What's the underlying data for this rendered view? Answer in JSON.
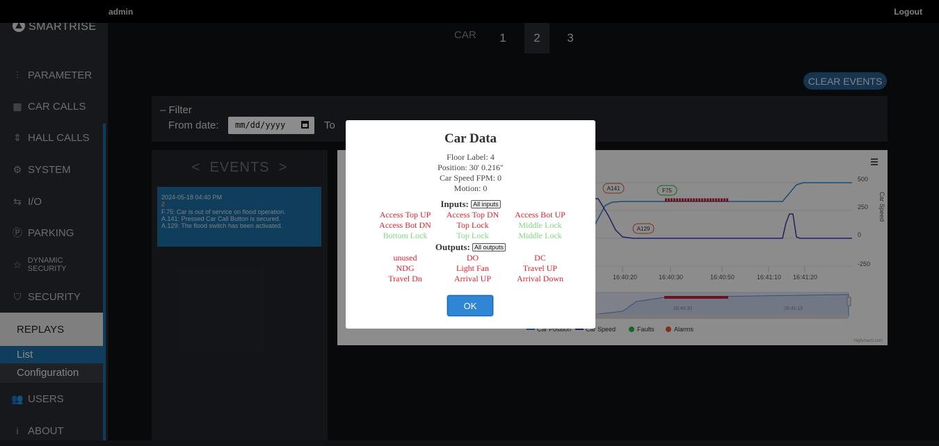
{
  "header": {
    "user": "admin",
    "logout": "Logout"
  },
  "brand": {
    "name": "SMARTRISE"
  },
  "sidebar": {
    "items": [
      {
        "label": "PARAMETER",
        "icon": "sliders-icon"
      },
      {
        "label": "CAR CALLS",
        "icon": "car-panel-icon"
      },
      {
        "label": "HALL CALLS",
        "icon": "up-down-icon"
      },
      {
        "label": "SYSTEM",
        "icon": "gear-icon"
      },
      {
        "label": "I/O",
        "icon": "io-arrows-icon"
      },
      {
        "label": "PARKING",
        "icon": "parking-icon"
      },
      {
        "label": "DYNAMIC SECURITY",
        "icon": "star-icon"
      },
      {
        "label": "SECURITY",
        "icon": "shield-icon"
      }
    ],
    "replays": {
      "label": "REPLAYS",
      "sub": [
        "List",
        "Configuration"
      ]
    },
    "bottom": [
      {
        "label": "USERS",
        "icon": "users-icon"
      },
      {
        "label": "ABOUT",
        "icon": "info-icon"
      }
    ]
  },
  "car_selector": {
    "label": "CAR",
    "cars": [
      "1",
      "2",
      "3"
    ],
    "active": "2"
  },
  "clear_events": "CLEAR EVENTS",
  "filter": {
    "title": "Filter",
    "from_label": "From date:",
    "from_value": "mm/dd/yyyy",
    "to_label": "To"
  },
  "events": {
    "title": "EVENTS",
    "card": {
      "timestamp": "2024-05-18 04:40 PM",
      "count": "2",
      "lines": [
        "F.75: Car is out of service on flood operation.",
        "A.141: Pressed Car Call Button is secured.",
        "A.129: The flood switch has been activated."
      ]
    }
  },
  "chart_data": {
    "type": "line",
    "y_ticks": [
      "500",
      "250",
      "0",
      "-250"
    ],
    "y_right_label": "Car Speed",
    "x_ticks": [
      "16:40:20",
      "16:40:30",
      "16:40:50",
      "16:41:10",
      "16:41:20"
    ],
    "navigator_ticks": [
      "16:40:30",
      "16:41:15"
    ],
    "flags": [
      "A141",
      "F75",
      "A129"
    ],
    "legend": [
      "Car Position",
      "Car Speed",
      "Faults",
      "Alarms"
    ],
    "credit": "Highcharts.com",
    "colors": {
      "car_position": "#2d8bd6",
      "car_speed": "#3b3bb0",
      "faults": "#2fb34a",
      "alarms": "#e8562f",
      "fault_band": "#c0263b"
    }
  },
  "modal": {
    "title": "Car Data",
    "floor_label": "Floor Label: 4",
    "position": "Position: 30' 0.216\"",
    "speed": "Car Speed FPM: 0",
    "motion": "Motion: 0",
    "inputs_head": "Inputs:",
    "inputs_btn": "All inputs",
    "inputs": [
      {
        "label": "Access Top UP",
        "state": "red"
      },
      {
        "label": "Access Top DN",
        "state": "red"
      },
      {
        "label": "Access Bot UP",
        "state": "red"
      },
      {
        "label": "Access Bot DN",
        "state": "red"
      },
      {
        "label": "Top Lock",
        "state": "red"
      },
      {
        "label": "Middle Lock",
        "state": "green"
      },
      {
        "label": "Bottom Lock",
        "state": "green"
      },
      {
        "label": "Top Lock",
        "state": "green"
      },
      {
        "label": "Middle Lock",
        "state": "green"
      }
    ],
    "outputs_head": "Outputs:",
    "outputs_btn": "All outputs",
    "outputs": [
      {
        "label": "unused",
        "state": "red"
      },
      {
        "label": "DO",
        "state": "red"
      },
      {
        "label": "DC",
        "state": "red"
      },
      {
        "label": "NDG",
        "state": "red"
      },
      {
        "label": "Light Fan",
        "state": "red"
      },
      {
        "label": "Travel UP",
        "state": "red"
      },
      {
        "label": "Travel Dn",
        "state": "red"
      },
      {
        "label": "Arrival UP",
        "state": "red"
      },
      {
        "label": "Arrival Down",
        "state": "red"
      }
    ],
    "ok": "OK"
  }
}
